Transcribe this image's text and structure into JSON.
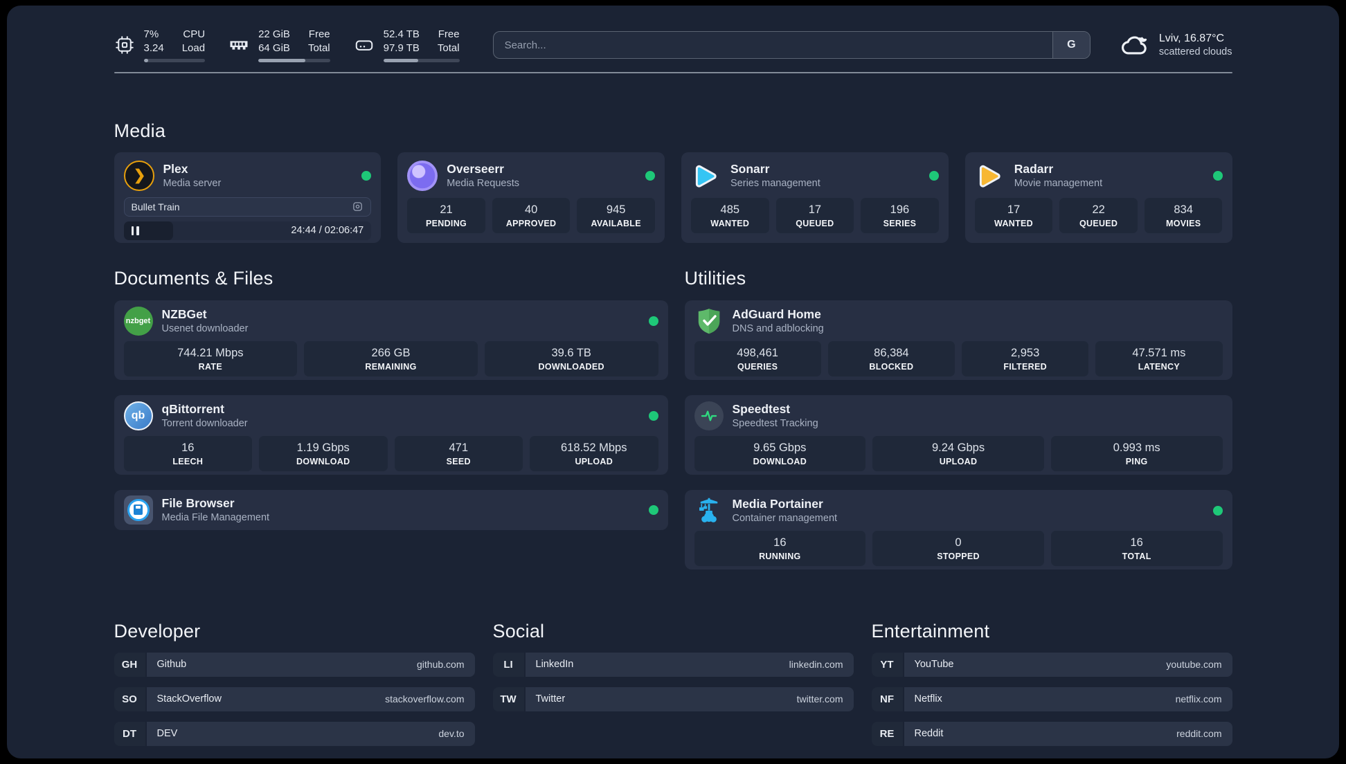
{
  "colors": {
    "background": "#1b2334",
    "card": "#272f43",
    "tile": "#1f2839",
    "status_green": "#1ec878",
    "plex_amber": "#e8a00c",
    "sonarr_cyan": "#35c5f4",
    "radarr_amber": "#f7b733",
    "nzbget_green": "#43a047",
    "adguard_green": "#5eb96a",
    "qbittorrent_blue": "#3a7bc8",
    "speedtest_green": "#2fd980",
    "portainer_blue": "#29b2ef"
  },
  "topbar": {
    "stats": [
      {
        "icon": "cpu-icon",
        "value_top": "7%",
        "value_bottom": "3.24",
        "label_top": "CPU",
        "label_bottom": "Load",
        "progress": 7
      },
      {
        "icon": "ram-icon",
        "value_top": "22 GiB",
        "value_bottom": "64 GiB",
        "label_top": "Free",
        "label_bottom": "Total",
        "progress": 66
      },
      {
        "icon": "disk-icon",
        "value_top": "52.4 TB",
        "value_bottom": "97.9 TB",
        "label_top": "Free",
        "label_bottom": "Total",
        "progress": 46
      }
    ],
    "search": {
      "placeholder": "Search...",
      "provider_label": "G"
    },
    "weather": {
      "location_temp": "Lviv, 16.87°C",
      "condition": "scattered clouds"
    }
  },
  "media": {
    "title": "Media",
    "cards": [
      {
        "name": "Plex",
        "sub": "Media server",
        "player": {
          "title": "Bullet Train",
          "time": "24:44 / 02:06:47",
          "progress": 20
        }
      },
      {
        "name": "Overseerr",
        "sub": "Media Requests",
        "stats": [
          {
            "value": "21",
            "label": "PENDING"
          },
          {
            "value": "40",
            "label": "APPROVED"
          },
          {
            "value": "945",
            "label": "AVAILABLE"
          }
        ]
      },
      {
        "name": "Sonarr",
        "sub": "Series management",
        "stats": [
          {
            "value": "485",
            "label": "WANTED"
          },
          {
            "value": "17",
            "label": "QUEUED"
          },
          {
            "value": "196",
            "label": "SERIES"
          }
        ]
      },
      {
        "name": "Radarr",
        "sub": "Movie management",
        "stats": [
          {
            "value": "17",
            "label": "WANTED"
          },
          {
            "value": "22",
            "label": "QUEUED"
          },
          {
            "value": "834",
            "label": "MOVIES"
          }
        ]
      }
    ]
  },
  "documents": {
    "title": "Documents & Files",
    "cards": [
      {
        "name": "NZBGet",
        "sub": "Usenet downloader",
        "stats": [
          {
            "value": "744.21 Mbps",
            "label": "RATE"
          },
          {
            "value": "266 GB",
            "label": "REMAINING"
          },
          {
            "value": "39.6 TB",
            "label": "DOWNLOADED"
          }
        ]
      },
      {
        "name": "qBittorrent",
        "sub": "Torrent downloader",
        "stats": [
          {
            "value": "16",
            "label": "LEECH"
          },
          {
            "value": "1.19 Gbps",
            "label": "DOWNLOAD"
          },
          {
            "value": "471",
            "label": "SEED"
          },
          {
            "value": "618.52 Mbps",
            "label": "UPLOAD"
          }
        ]
      },
      {
        "name": "File Browser",
        "sub": "Media File Management"
      }
    ]
  },
  "utilities": {
    "title": "Utilities",
    "cards": [
      {
        "name": "AdGuard Home",
        "sub": "DNS and adblocking",
        "stats": [
          {
            "value": "498,461",
            "label": "QUERIES"
          },
          {
            "value": "86,384",
            "label": "BLOCKED"
          },
          {
            "value": "2,953",
            "label": "FILTERED"
          },
          {
            "value": "47.571 ms",
            "label": "LATENCY"
          }
        ]
      },
      {
        "name": "Speedtest",
        "sub": "Speedtest Tracking",
        "stats": [
          {
            "value": "9.65 Gbps",
            "label": "DOWNLOAD"
          },
          {
            "value": "9.24 Gbps",
            "label": "UPLOAD"
          },
          {
            "value": "0.993 ms",
            "label": "PING"
          }
        ]
      },
      {
        "name": "Media Portainer",
        "sub": "Container management",
        "stats": [
          {
            "value": "16",
            "label": "RUNNING"
          },
          {
            "value": "0",
            "label": "STOPPED"
          },
          {
            "value": "16",
            "label": "TOTAL"
          }
        ]
      }
    ]
  },
  "links": [
    {
      "title": "Developer",
      "items": [
        {
          "abbr": "GH",
          "name": "Github",
          "url": "github.com"
        },
        {
          "abbr": "SO",
          "name": "StackOverflow",
          "url": "stackoverflow.com"
        },
        {
          "abbr": "DT",
          "name": "DEV",
          "url": "dev.to"
        }
      ]
    },
    {
      "title": "Social",
      "items": [
        {
          "abbr": "LI",
          "name": "LinkedIn",
          "url": "linkedin.com"
        },
        {
          "abbr": "TW",
          "name": "Twitter",
          "url": "twitter.com"
        }
      ]
    },
    {
      "title": "Entertainment",
      "items": [
        {
          "abbr": "YT",
          "name": "YouTube",
          "url": "youtube.com"
        },
        {
          "abbr": "NF",
          "name": "Netflix",
          "url": "netflix.com"
        },
        {
          "abbr": "RE",
          "name": "Reddit",
          "url": "reddit.com"
        }
      ]
    }
  ]
}
